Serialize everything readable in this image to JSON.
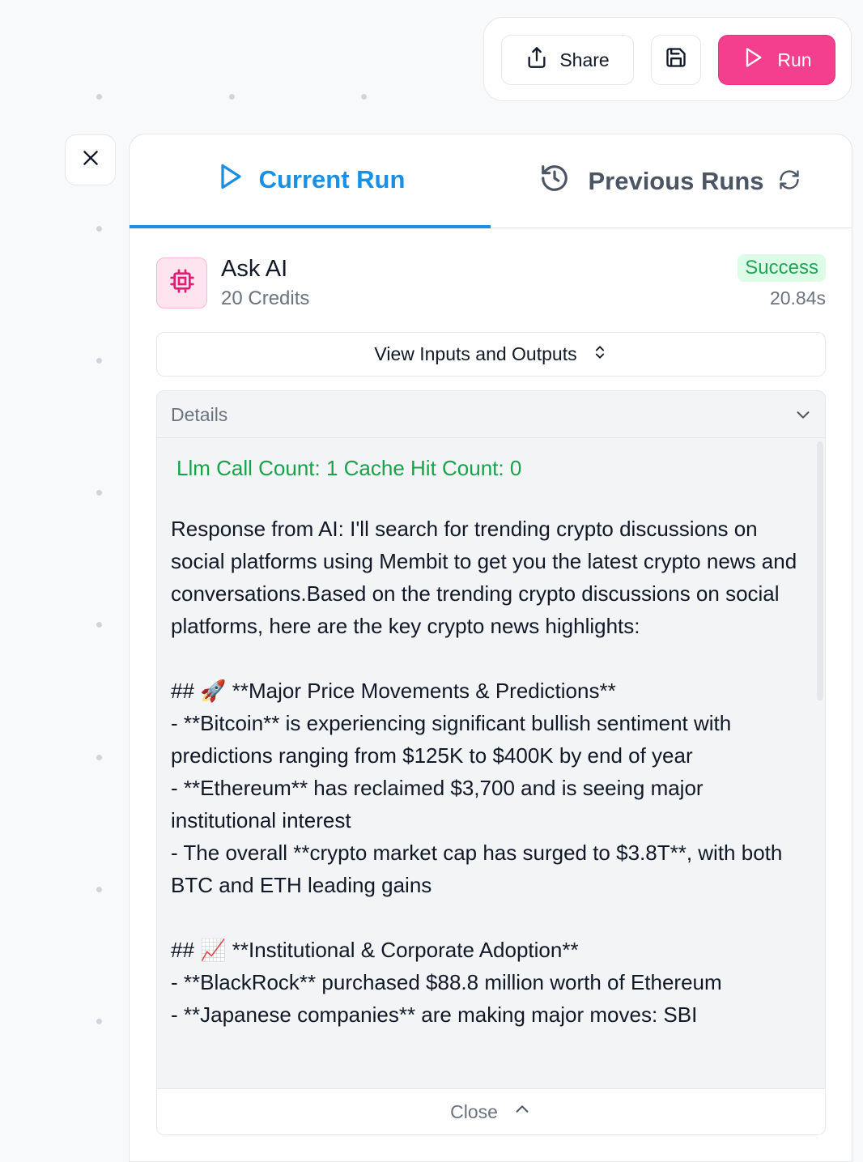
{
  "toolbar": {
    "share_label": "Share",
    "run_label": "Run"
  },
  "tabs": {
    "current": "Current Run",
    "previous": "Previous Runs"
  },
  "node": {
    "title": "Ask AI",
    "credits": "20 Credits",
    "status": "Success",
    "duration": "20.84s"
  },
  "io_button_label": "View Inputs and Outputs",
  "details": {
    "label": "Details",
    "stats": "Llm Call Count: 1 Cache Hit Count: 0",
    "response": "Response from AI: I'll search for trending crypto discussions on social platforms using Membit to get you the latest crypto news and conversations.Based on the trending crypto discussions on social platforms, here are the key crypto news highlights:\n\n## 🚀 **Major Price Movements & Predictions**\n- **Bitcoin** is experiencing significant bullish sentiment with predictions ranging from $125K to $400K by end of year\n- **Ethereum** has reclaimed $3,700 and is seeing major institutional interest\n- The overall **crypto market cap has surged to $3.8T**, with both BTC and ETH leading gains\n\n## 📈 **Institutional & Corporate Adoption**\n- **BlackRock** purchased $88.8 million worth of Ethereum\n- **Japanese companies** are making major moves: SBI",
    "close_label": "Close"
  },
  "colors": {
    "accent_blue": "#1a8fe6",
    "run_pink": "#f43f8e",
    "success_green": "#16a34a",
    "chip_pink": "#e11d74"
  },
  "icons": [
    "share-icon",
    "save-icon",
    "play-icon",
    "close-icon",
    "history-icon",
    "refresh-icon",
    "chip-icon",
    "chevron-updown-icon",
    "chevron-down-icon",
    "chevron-up-icon"
  ]
}
